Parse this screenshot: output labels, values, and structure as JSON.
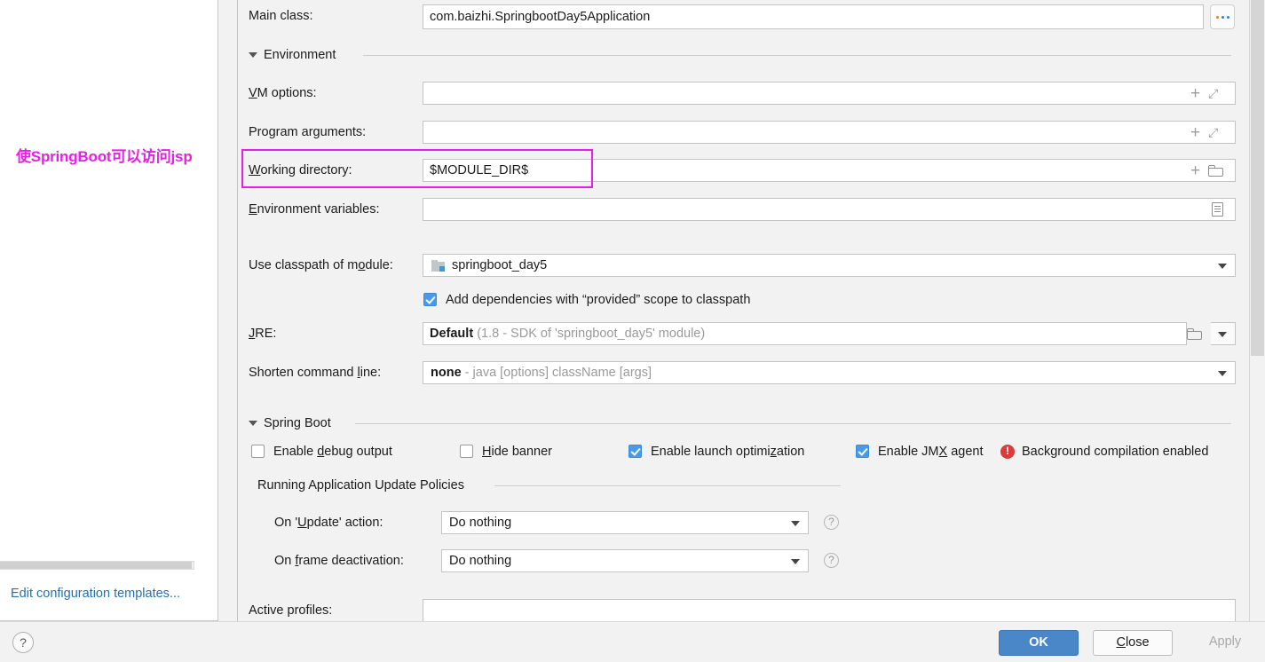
{
  "annotation": {
    "text": "使SpringBoot可以访问jsp",
    "color": "#e81ee8",
    "highlight_target": "working-directory-row"
  },
  "left_panel": {
    "edit_templates_link": "Edit configuration templates..."
  },
  "form": {
    "main_class": {
      "label": "Main class:",
      "value": "com.baizhi.SpringbootDay5Application",
      "browse_button": "..."
    },
    "environment_section": {
      "title": "Environment",
      "collapsed": false
    },
    "vm_options": {
      "label": "VM options:",
      "label_mnemonic": "V",
      "value": "",
      "icons": [
        "plus-icon",
        "expand-icon"
      ]
    },
    "program_arguments": {
      "label": "Program arguments:",
      "label_mnemonic": "g",
      "value": "",
      "icons": [
        "plus-icon",
        "expand-icon"
      ]
    },
    "working_directory": {
      "label": "Working directory:",
      "label_mnemonic": "W",
      "value": "$MODULE_DIR$",
      "icons": [
        "plus-icon",
        "folder-icon"
      ]
    },
    "environment_variables": {
      "label": "Environment variables:",
      "label_mnemonic": "E",
      "value": "",
      "icons": [
        "document-icon"
      ]
    },
    "use_classpath_of_module": {
      "label": "Use classpath of module:",
      "label_mnemonic": "o",
      "value": "springboot_day5",
      "icon": "module-icon"
    },
    "add_dependencies": {
      "label": "Add dependencies with “provided” scope to classpath",
      "checked": true
    },
    "jre": {
      "label": "JRE:",
      "label_mnemonic": "J",
      "value": "Default",
      "value_hint": "(1.8 - SDK of 'springboot_day5' module)",
      "icons": [
        "folder-icon",
        "chevron-down-icon"
      ]
    },
    "shorten_command_line": {
      "label": "Shorten command line:",
      "label_mnemonic": "l",
      "value": "none",
      "value_hint": "- java [options] className [args]"
    },
    "spring_boot_section": {
      "title": "Spring Boot",
      "collapsed": false,
      "checkboxes": [
        {
          "label": "Enable debug output",
          "mnemonic": "d",
          "checked": false
        },
        {
          "label": "Hide banner",
          "mnemonic": "H",
          "checked": false
        },
        {
          "label": "Enable launch optimization",
          "mnemonic": "z",
          "checked": true
        },
        {
          "label": "Enable JMX agent",
          "mnemonic": "X",
          "checked": true
        }
      ],
      "warning": {
        "text": "Background compilation enabled",
        "icon": "error-circle-icon",
        "color": "#db3b3b"
      }
    },
    "update_policies": {
      "title": "Running Application Update Policies",
      "rows": [
        {
          "label": "On 'Update' action:",
          "mnemonic": "U",
          "value": "Do nothing",
          "help": "?"
        },
        {
          "label": "On frame deactivation:",
          "mnemonic": "f",
          "value": "Do nothing",
          "help": "?"
        }
      ]
    },
    "active_profiles": {
      "label": "Active profiles:",
      "value": ""
    }
  },
  "footer": {
    "help_button": "?",
    "ok_button": "OK",
    "close_button": "Close",
    "close_mnemonic": "C",
    "apply_button": "Apply",
    "apply_disabled": true
  }
}
